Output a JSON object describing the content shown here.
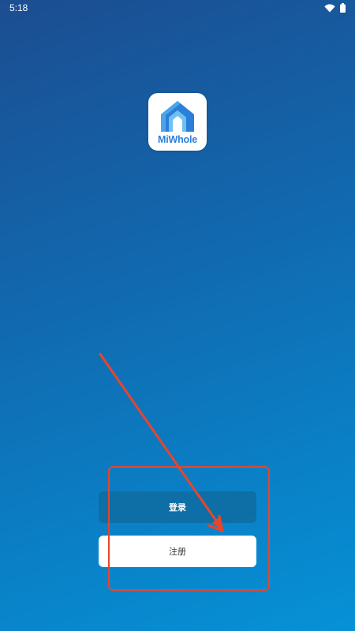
{
  "status_bar": {
    "time": "5:18",
    "icons": [
      "wifi-icon",
      "battery-icon"
    ]
  },
  "app": {
    "logo_text": "MiWhole",
    "logo_colors": {
      "primary": "#2b7fd8",
      "light": "#6fc0f2"
    }
  },
  "buttons": {
    "login_label": "登录",
    "register_label": "注册"
  },
  "colors": {
    "background_top": "#1c4d91",
    "background_bottom": "#0691d6",
    "annotation": "#e8452c"
  }
}
